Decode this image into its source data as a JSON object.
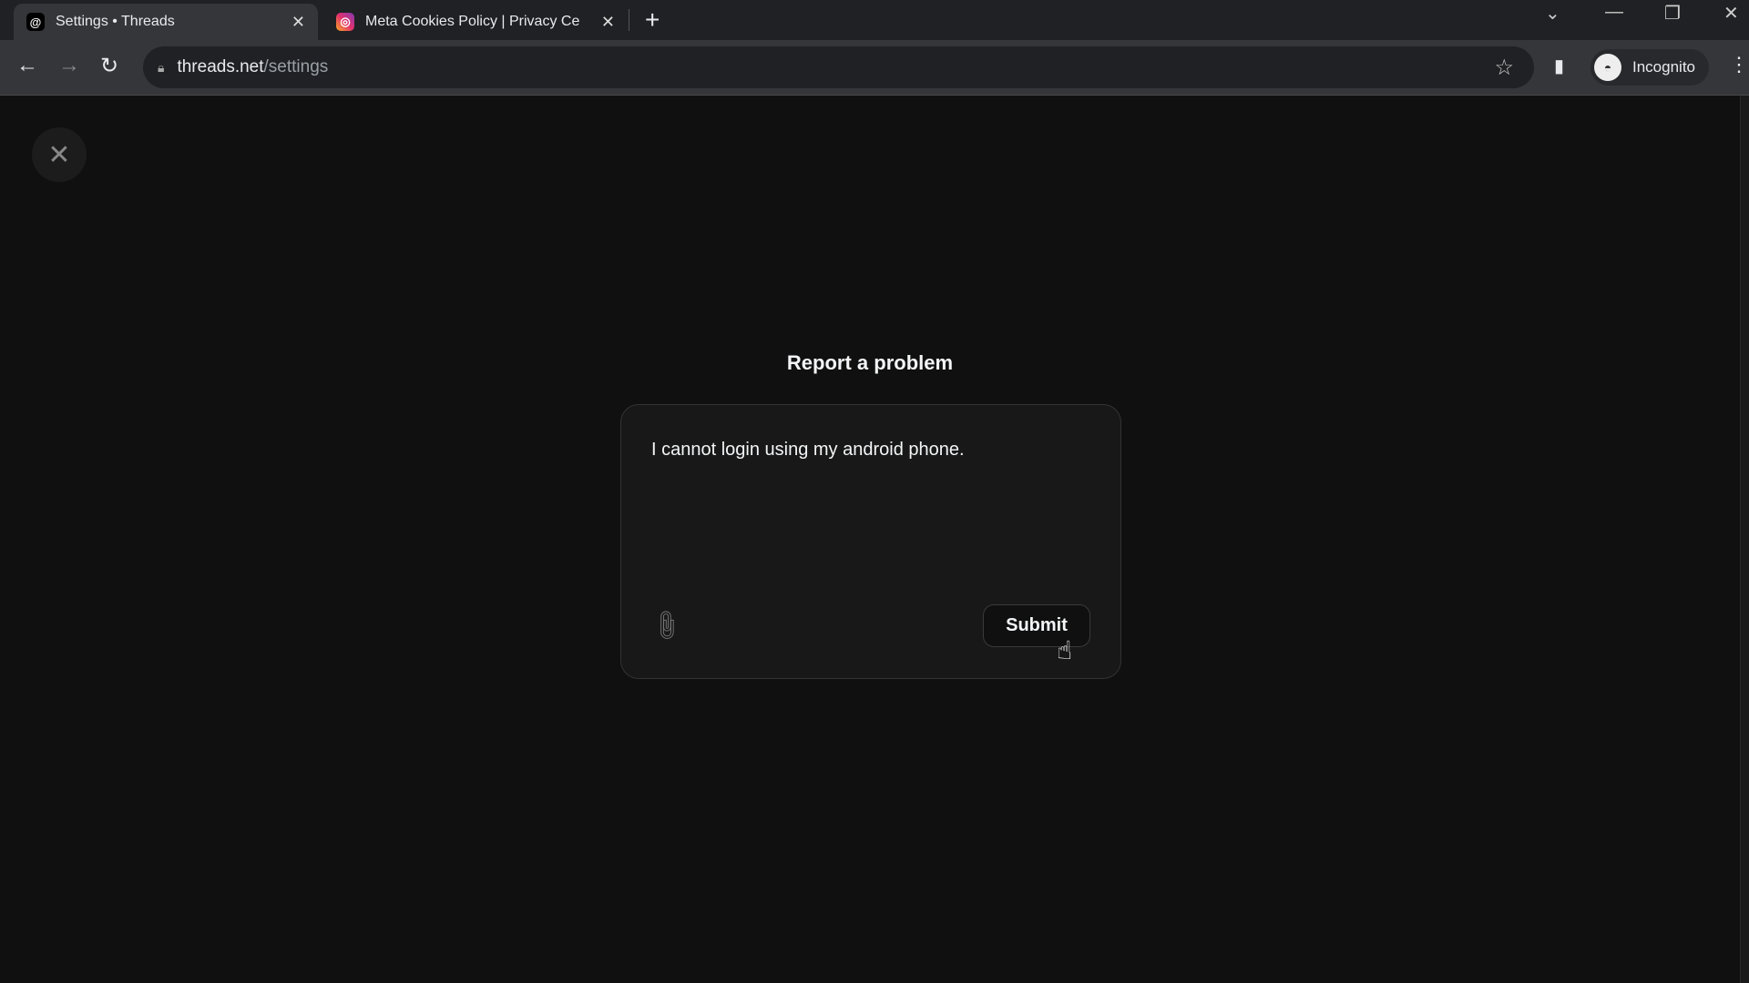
{
  "browser": {
    "tabs": [
      {
        "title": "Settings • Threads",
        "icon": "threads-icon",
        "active": true
      },
      {
        "title": "Meta Cookies Policy | Privacy Ce",
        "icon": "instagram-icon",
        "active": false
      }
    ],
    "new_tab": "+",
    "url_host": "threads.net",
    "url_path": "/settings",
    "profile_label": "Incognito"
  },
  "dialog": {
    "title": "Report a problem",
    "message": "I cannot login using my android phone.",
    "submit_label": "Submit",
    "close_icon": "close-icon",
    "attach_icon": "paperclip-icon"
  }
}
